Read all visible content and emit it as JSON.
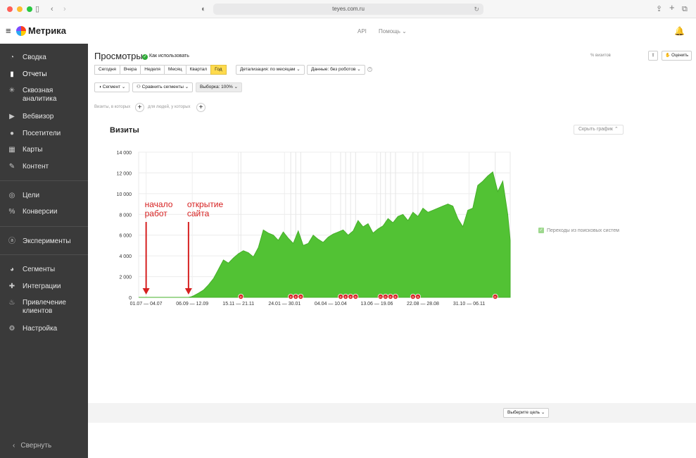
{
  "browser": {
    "url": "teyes.com.ru"
  },
  "header": {
    "brand": "Метрика",
    "api_link": "API",
    "help_link": "Помощь"
  },
  "sidebar": {
    "items": [
      {
        "label": "Сводка",
        "icon": "gauge-icon"
      },
      {
        "label": "Отчеты",
        "icon": "bar-chart-icon"
      },
      {
        "label": "Сквозная аналитика",
        "icon": "network-icon"
      },
      {
        "label": "Вебвизор",
        "icon": "play-icon"
      },
      {
        "label": "Посетители",
        "icon": "user-icon"
      },
      {
        "label": "Карты",
        "icon": "map-icon"
      },
      {
        "label": "Контент",
        "icon": "pencil-icon"
      },
      {
        "label": "Цели",
        "icon": "target-icon"
      },
      {
        "label": "Конверсии",
        "icon": "percent-icon"
      },
      {
        "label": "Эксперименты",
        "icon": "ab-icon"
      },
      {
        "label": "Сегменты",
        "icon": "pie-icon"
      },
      {
        "label": "Интеграции",
        "icon": "puzzle-icon"
      },
      {
        "label": "Привлечение клиентов",
        "icon": "fire-icon"
      },
      {
        "label": "Настройка",
        "icon": "gear-icon"
      }
    ],
    "collapse_label": "Свернуть"
  },
  "report": {
    "title": "Просмотры",
    "howto": "Как использовать",
    "visits_pct": "% визитов",
    "rate_label": "Оценить",
    "periods": [
      "Сегодня",
      "Вчера",
      "Неделя",
      "Месяц",
      "Квартал",
      "Год"
    ],
    "selected_period": "Год",
    "detail": "Детализация: по месяцам",
    "data_mode": "Данные: без роботов",
    "segment": "Сегмент",
    "compare": "Сравнить сегменты",
    "sample": "Выборка: 100%",
    "filter_visits": "Визиты, в которых",
    "filter_people": "для людей, у которых",
    "goal_select": "Выберите цель"
  },
  "chart_data": {
    "type": "area",
    "title": "Визиты",
    "hide_label": "Скрыть график",
    "legend": [
      "Переходы из поисковых систем"
    ],
    "color": "#52c234",
    "ylim": [
      0,
      14000
    ],
    "yticks": [
      "14 000",
      "12 000",
      "10 000",
      "8 000",
      "6 000",
      "4 000",
      "2 000",
      "0"
    ],
    "xticks": [
      "01.07 — 04.07",
      "06.09 — 12.09",
      "15.11 — 21.11",
      "24.01 — 30.01",
      "04.04 — 10.04",
      "13.06 — 19.06",
      "22.08 — 28.08",
      "31.10 — 06.11"
    ],
    "series": [
      {
        "name": "Переходы из поисковых систем",
        "x": [
          0,
          5,
          10,
          10.5,
          11,
          12,
          13,
          14,
          15,
          16,
          17,
          18,
          19,
          20,
          21,
          22,
          23,
          24,
          25,
          26,
          27,
          28,
          29,
          30,
          31,
          32,
          33,
          34,
          35,
          36,
          37,
          38,
          39,
          40,
          41,
          42,
          43,
          44,
          45,
          46,
          47,
          48,
          49,
          50,
          51,
          52,
          53,
          54,
          55,
          56,
          57,
          58,
          59,
          60,
          61,
          62,
          63,
          64,
          65,
          66,
          67,
          68,
          69,
          70,
          71,
          72,
          73,
          74,
          74.5
        ],
        "values": [
          0,
          0,
          0,
          50,
          150,
          400,
          700,
          1200,
          1800,
          2700,
          3600,
          3300,
          3800,
          4200,
          4500,
          4300,
          3900,
          4800,
          6500,
          6200,
          6000,
          5500,
          6300,
          5700,
          5200,
          6400,
          5000,
          5200,
          6000,
          5600,
          5300,
          5800,
          6100,
          6300,
          6500,
          6000,
          6400,
          7400,
          6800,
          7100,
          6200,
          6600,
          6900,
          7600,
          7200,
          7800,
          8000,
          7400,
          8200,
          7800,
          8600,
          8200,
          8400,
          8600,
          8800,
          9000,
          8800,
          7600,
          6800,
          8400,
          8600,
          10800,
          11200,
          11700,
          12100,
          10200,
          11200,
          8000,
          5500
        ]
      }
    ],
    "annotations": [
      {
        "text": "начало работ",
        "at": 1.5
      },
      {
        "text": "открытие сайта",
        "at": 10
      }
    ],
    "markers": [
      20.5,
      30.5,
      31.5,
      32.5,
      40.5,
      41.5,
      42.5,
      43.5,
      48.5,
      49.5,
      50.5,
      51.5,
      55,
      56,
      71.5
    ],
    "marker_glyph": "R"
  }
}
